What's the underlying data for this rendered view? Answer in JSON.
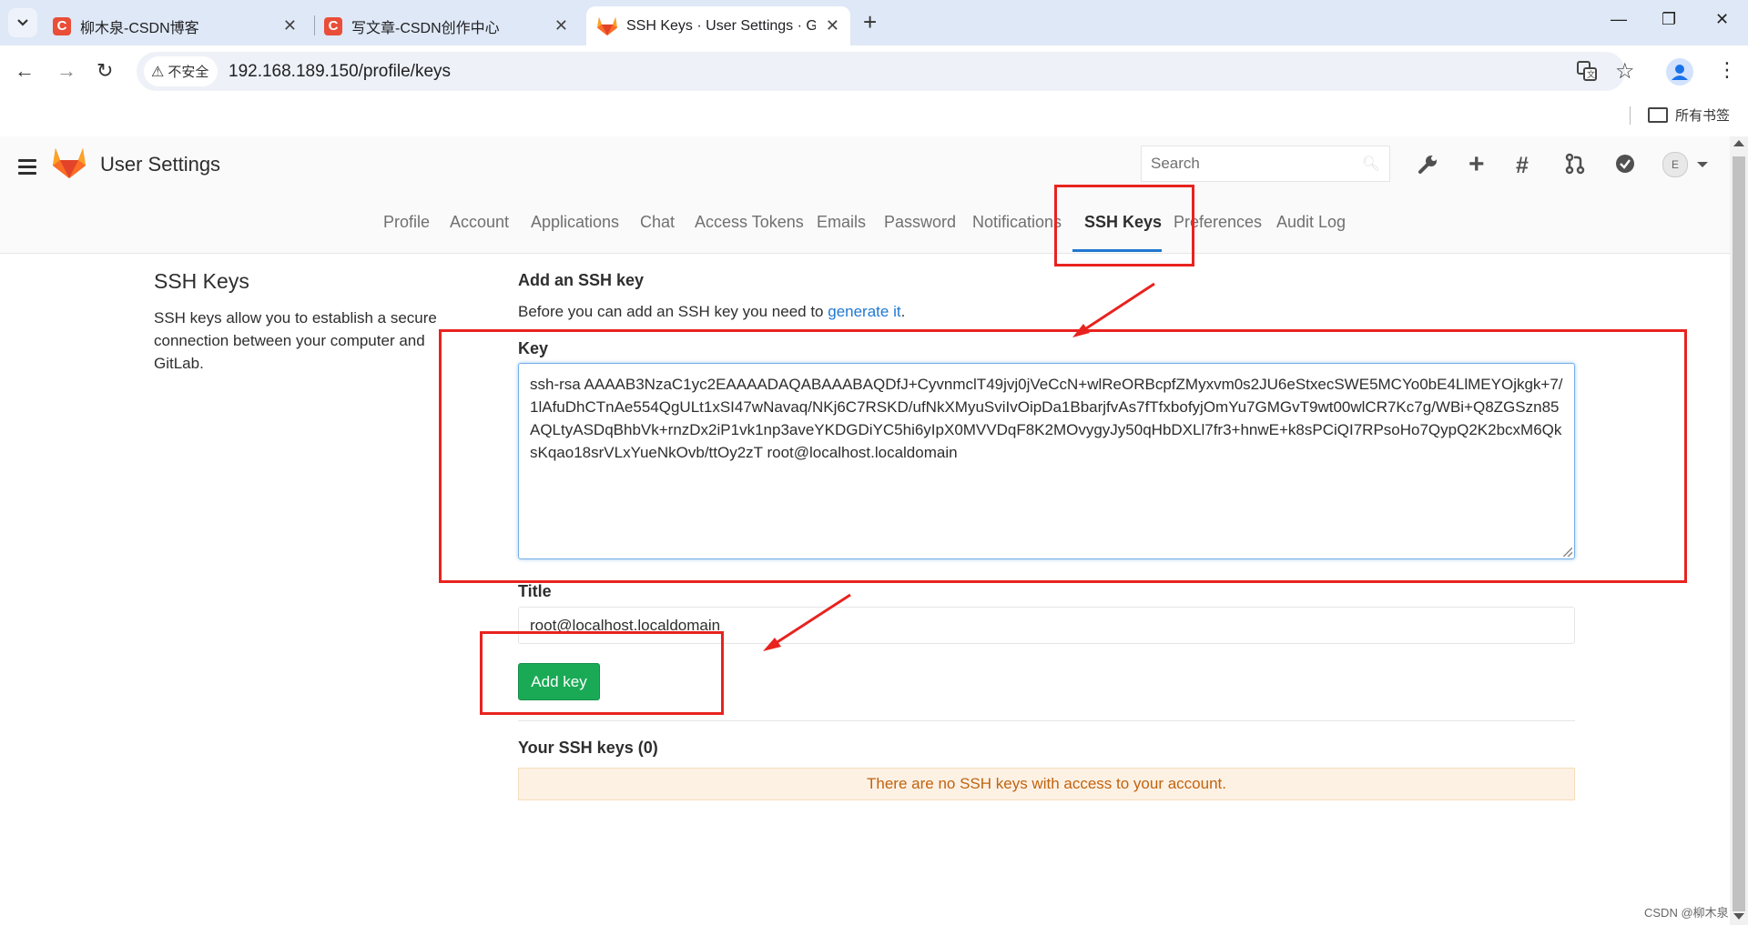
{
  "browser": {
    "tabs": [
      {
        "title": "柳木泉-CSDN博客",
        "icon": "csdn-icon"
      },
      {
        "title": "写文章-CSDN创作中心",
        "icon": "csdn-icon"
      },
      {
        "title": "SSH Keys · User Settings · Git",
        "icon": "gitlab-icon",
        "active": true
      }
    ],
    "address_bar": {
      "security_label": "不安全",
      "url": "192.168.189.150/profile/keys"
    },
    "bookmarks_folder": "所有书签"
  },
  "gitlab": {
    "header": {
      "title": "User Settings",
      "search_placeholder": "Search"
    },
    "nav_tabs": [
      "Profile",
      "Account",
      "Applications",
      "Chat",
      "Access Tokens",
      "Emails",
      "Password",
      "Notifications",
      "SSH Keys",
      "Preferences",
      "Audit Log"
    ],
    "active_tab": "SSH Keys",
    "sidebar": {
      "title": "SSH Keys",
      "description": "SSH keys allow you to establish a secure connection between your computer and GitLab."
    },
    "form": {
      "heading": "Add an SSH key",
      "help_prefix": "Before you can add an SSH key you need to ",
      "help_link": "generate it",
      "help_suffix": ".",
      "key_label": "Key",
      "key_value": "ssh-rsa AAAAB3NzaC1yc2EAAAADAQABAAABAQDfJ+CyvnmclT49jvj0jVeCcN+wlReORBcpfZMyxvm0s2JU6eStxecSWE5MCYo0bE4LlMEYOjkgk+7/1lAfuDhCTnAe554QgULt1xSI47wNavaq/NKj6C7RSKD/ufNkXMyuSviIvOipDa1BbarjfvAs7fTfxbofyjOmYu7GMGvT9wt00wlCR7Kc7g/WBi+Q8ZGSzn85AQLtyASDqBhbVk+rnzDx2iP1vk1np3aveYKDGDiYC5hi6yIpX0MVVDqF8K2MOvygyJy50qHbDXLl7fr3+hnwE+k8sPCiQI7RPsoHo7QypQ2K2bcxM6QksKqao18srVLxYueNkOvb/ttOy2zT root@localhost.localdomain",
      "title_label": "Title",
      "title_value": "root@localhost.localdomain",
      "submit_label": "Add key"
    },
    "keys_list": {
      "heading": "Your SSH keys (0)",
      "empty_message": "There are no SSH keys with access to your account."
    }
  },
  "watermark": "CSDN @柳木泉",
  "colors": {
    "accent": "#1f78d1",
    "success": "#1aaa55",
    "annotation": "#e8231f",
    "warning_text": "#c0640f"
  }
}
